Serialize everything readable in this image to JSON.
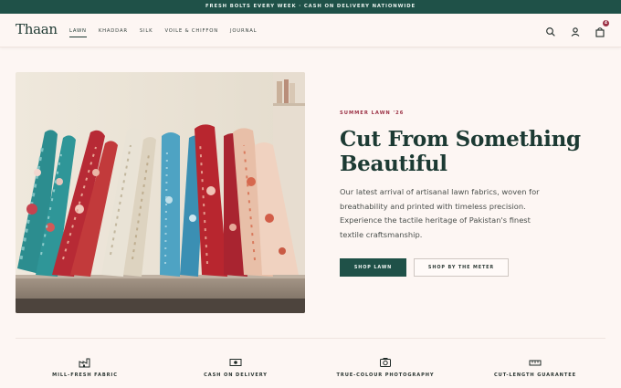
{
  "announcement": "FRESH BOLTS EVERY WEEK · CASH ON DELIVERY NATIONWIDE",
  "header": {
    "logo": "Thaan",
    "nav": [
      "LAWN",
      "KHADDAR",
      "SILK",
      "VOILE & CHIFFON",
      "JOURNAL"
    ],
    "active_nav": "LAWN",
    "icons": [
      "search-icon",
      "account-icon",
      "bag-icon"
    ],
    "cart_count": "4"
  },
  "hero": {
    "image": "fabric-rolls-photo",
    "eyebrow": "SUMMER LAWN '26",
    "headline_line1": "Cut From Something",
    "headline_line2": "Beautiful",
    "description": "Our latest arrival of artisanal lawn fabrics, woven for breathability and printed with timeless precision. Experience the tactile heritage of Pakistan's finest textile craftsmanship.",
    "primary_cta": "SHOP LAWN",
    "secondary_cta": "SHOP BY THE METER"
  },
  "features": [
    {
      "icon": "factory-icon",
      "label": "MILL-FRESH FABRIC"
    },
    {
      "icon": "cash-icon",
      "label": "CASH ON DELIVERY"
    },
    {
      "icon": "camera-icon",
      "label": "TRUE-COLOUR PHOTOGRAPHY"
    },
    {
      "icon": "ruler-icon",
      "label": "CUT-LENGTH GUARANTEE"
    }
  ],
  "colors": {
    "brand": "#1f5148",
    "accent": "#9b3044",
    "background": "#fdf6f3"
  }
}
